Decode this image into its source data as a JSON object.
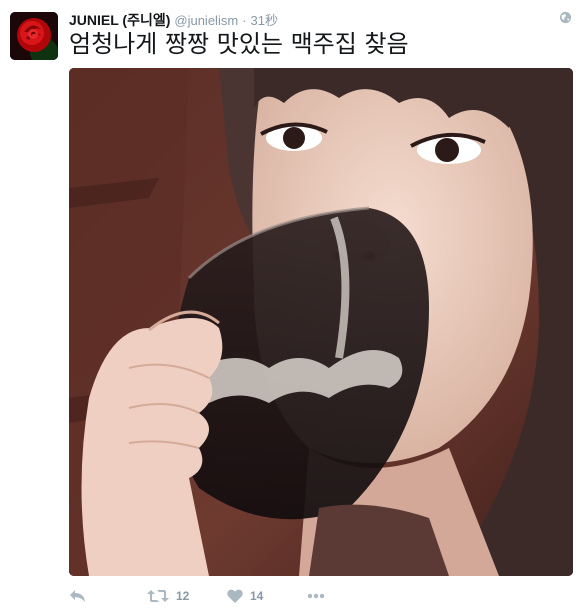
{
  "tweet": {
    "display_name": "JUNIEL (주니엘)",
    "handle": "@junielism",
    "separator": "·",
    "time": "31秒",
    "text": "엄청나게 짱짱 맛있는 맥주집 찾음"
  },
  "icons": {
    "avatar": "red-rose-avatar",
    "globe": "globe-icon",
    "reply": "reply-icon",
    "retweet": "retweet-icon",
    "like": "heart-icon",
    "more": "more-icon"
  },
  "actions": {
    "retweet_count": "12",
    "like_count": "14"
  },
  "colors": {
    "text": "#14171a",
    "muted": "#8899a6",
    "icon": "#aab8c2"
  }
}
